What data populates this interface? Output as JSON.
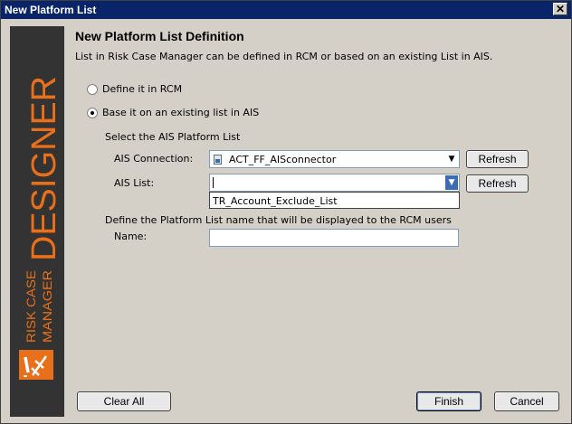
{
  "window": {
    "title": "New Platform List",
    "close_symbol": "✕"
  },
  "sidebar": {
    "brand_big": "DESIGNER",
    "brand_small_1": "RISK CASE",
    "brand_small_2": "MANAGER",
    "colors": {
      "background": "#333333",
      "accent": "#e8701a"
    }
  },
  "main": {
    "heading": "New Platform List Definition",
    "description": "List in Risk Case Manager can be defined in RCM or based on an existing List in AIS.",
    "options": [
      {
        "label": "Define it in RCM",
        "checked": false
      },
      {
        "label": "Base it on an existing list in AIS",
        "checked": true
      }
    ],
    "ais_section_label": "Select the AIS Platform List",
    "ais_connection": {
      "label": "AIS Connection:",
      "value": "ACT_FF_AISconnector",
      "icon": "connector-icon"
    },
    "ais_list": {
      "label": "AIS List:",
      "value": "",
      "dropdown_items": [
        "TR_Account_Exclude_List"
      ]
    },
    "refresh_label": "Refresh",
    "name_section_label": "Define the Platform List name that will be displayed to the RCM users",
    "name_field": {
      "label": "Name:",
      "value": ""
    }
  },
  "footer": {
    "clear_all": "Clear All",
    "finish": "Finish",
    "cancel": "Cancel"
  }
}
